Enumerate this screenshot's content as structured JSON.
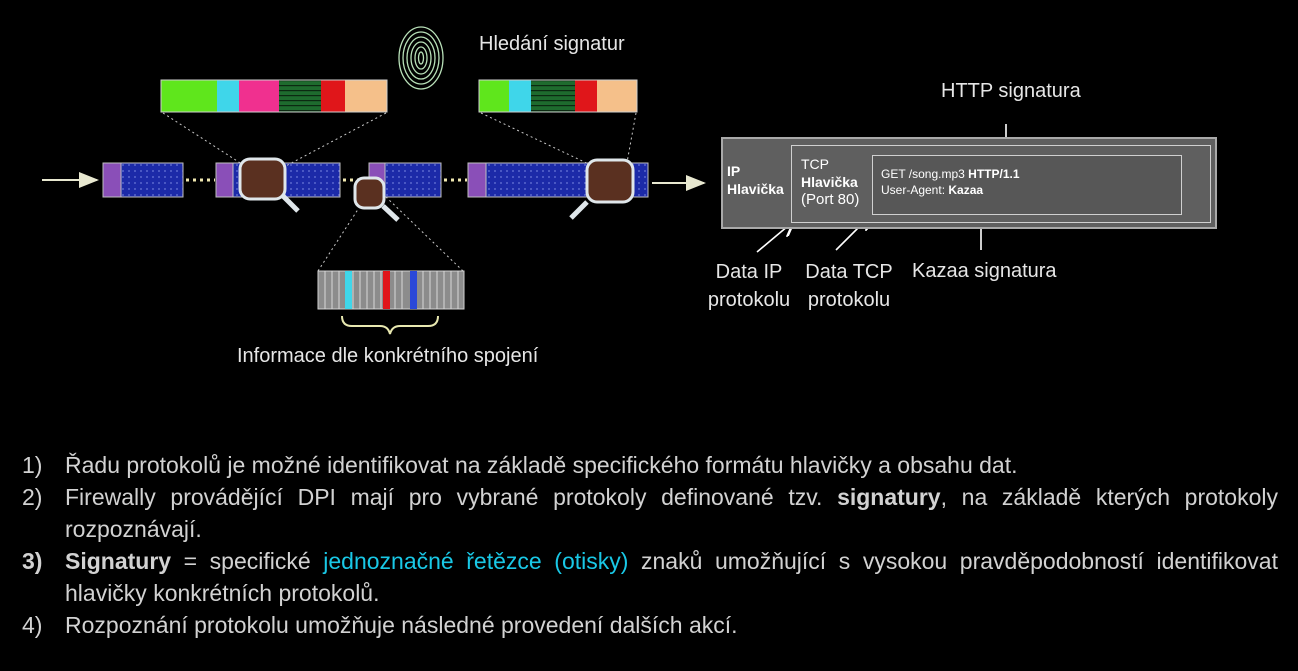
{
  "diagram": {
    "label_signature_search": "Hledání signatur",
    "label_http_signature": "HTTP signatura",
    "label_connection_info": "Informace dle konkrétního spojení",
    "label_ip_data_line1": "Data IP",
    "label_ip_data_line2": "protokolu",
    "label_tcp_data_line1": "Data TCP",
    "label_tcp_data_line2": "protokolu",
    "label_kazaa_signature": "Kazaa signatura",
    "ip_header_line1": "IP",
    "ip_header_line2": "Hlavička",
    "tcp_header_line1": "TCP",
    "tcp_header_line2": "Hlavička",
    "tcp_header_line3": "(Port 80)",
    "payload_get": "GET /song.mp3 ",
    "payload_http": "HTTP/1.1",
    "payload_ua": "User-Agent: ",
    "payload_kazaa": "Kazaa",
    "colors": {
      "packet_blue": "#1c2aa8",
      "packet_purple": "#8a4fb8",
      "bar_green": "#5fe61c",
      "bar_cyan": "#3fd6ea",
      "bar_pink": "#f0308f",
      "bar_red": "#e0161a",
      "bar_peach": "#f5c08a",
      "highlight_text": "#19c8e6"
    }
  },
  "list": {
    "item1_num": "1)",
    "item1_text": "Řadu protokolů je možné identifikovat na základě specifického formátu hlavičky a obsahu dat.",
    "item2_num": "2)",
    "item2_text_a": "Firewally provádějící DPI mají pro vybrané protokoly definované tzv. ",
    "item2_bold": "signatury",
    "item2_text_b": ", na základě kterých protokoly rozpoznávají.",
    "item3_num": "3)",
    "item3_bold": "Signatury",
    "item3_text_a": " = specifické ",
    "item3_highlight": "jednoznačné řetězce (otisky)",
    "item3_text_b": " znaků umožňující s vysokou pravděpodobností identifikovat  hlavičky konkrétních protokolů.",
    "item4_num": "4)",
    "item4_text": "Rozpoznání protokolu umožňuje následné provedení dalších akcí."
  }
}
